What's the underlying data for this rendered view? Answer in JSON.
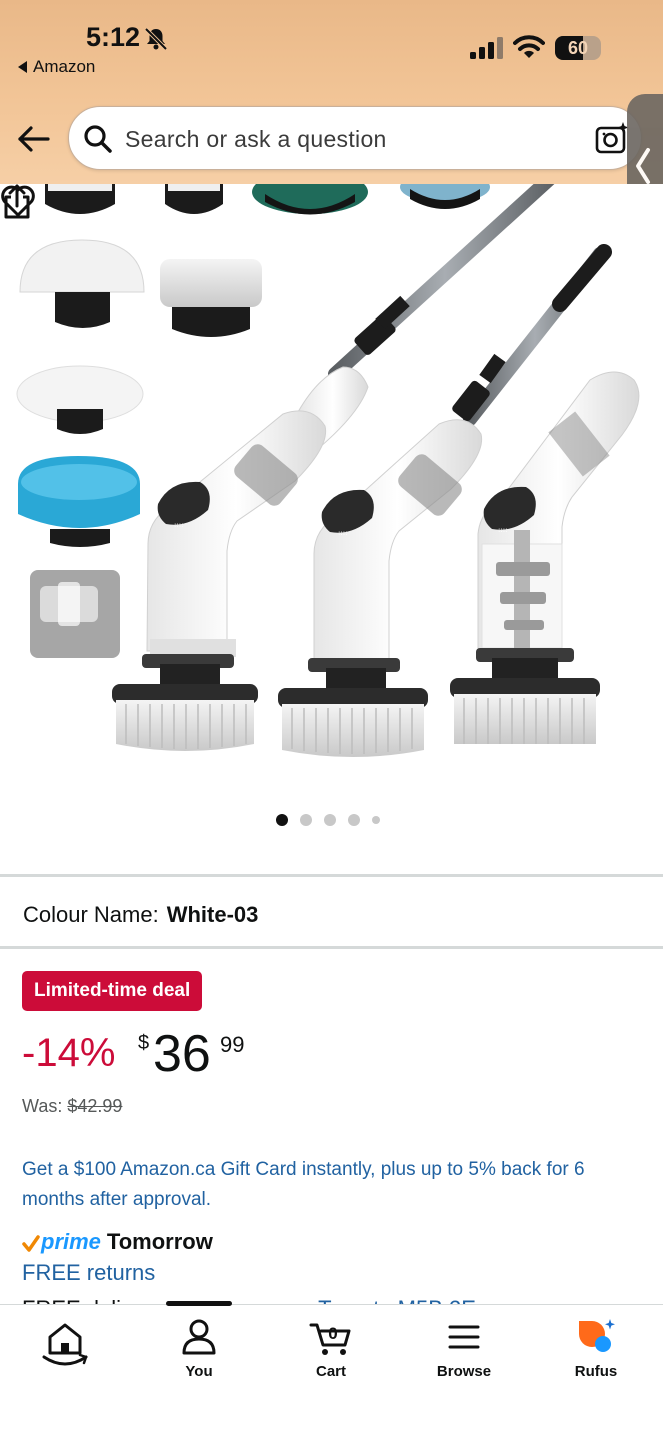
{
  "status_bar": {
    "time": "5:12",
    "back_app": "Amazon",
    "battery": "60",
    "battery_level": 0.6,
    "icons": [
      "bell-slash-icon",
      "signal-icon",
      "wifi-icon",
      "battery-icon"
    ]
  },
  "header": {
    "search_placeholder": "Search or ask a question",
    "icons": [
      "back-arrow-icon",
      "search-icon",
      "camera-icon",
      "side-panel-chevron-icon"
    ]
  },
  "gallery": {
    "image_count": 5,
    "active_index": 0,
    "icons": [
      "heart-icon",
      "share-icon"
    ]
  },
  "product": {
    "colour_label": "Colour Name:",
    "colour_value": "White-03",
    "deal_badge": "Limited-time deal",
    "discount": "-14%",
    "price_symbol": "$",
    "price_whole": "36",
    "price_fraction": "99",
    "was_label": "Was:",
    "was_price": "$42.99",
    "promo": "Get a $100 Amazon.ca Gift Card instantly, plus up to 5% back for 6 months after approval.",
    "prime_word": "prime",
    "prime_delivery": "Tomorrow",
    "free_returns": "FREE returns",
    "cut_line_prefix": "FREE deliv",
    "cut_line_link": "Toronto M5B 2E"
  },
  "bottom_nav": {
    "items": [
      {
        "label": "",
        "icon": "home-icon"
      },
      {
        "label": "You",
        "icon": "person-icon"
      },
      {
        "label": "Cart",
        "icon": "cart-icon",
        "count": "0"
      },
      {
        "label": "Browse",
        "icon": "menu-icon"
      },
      {
        "label": "Rufus",
        "icon": "rufus-icon"
      }
    ]
  },
  "colors": {
    "header_bg": "#f2c597",
    "deal_red": "#cc0c39",
    "link_blue": "#2162a1",
    "prime_blue": "#1a98ff",
    "rufus_orange": "#ff6a1a"
  }
}
